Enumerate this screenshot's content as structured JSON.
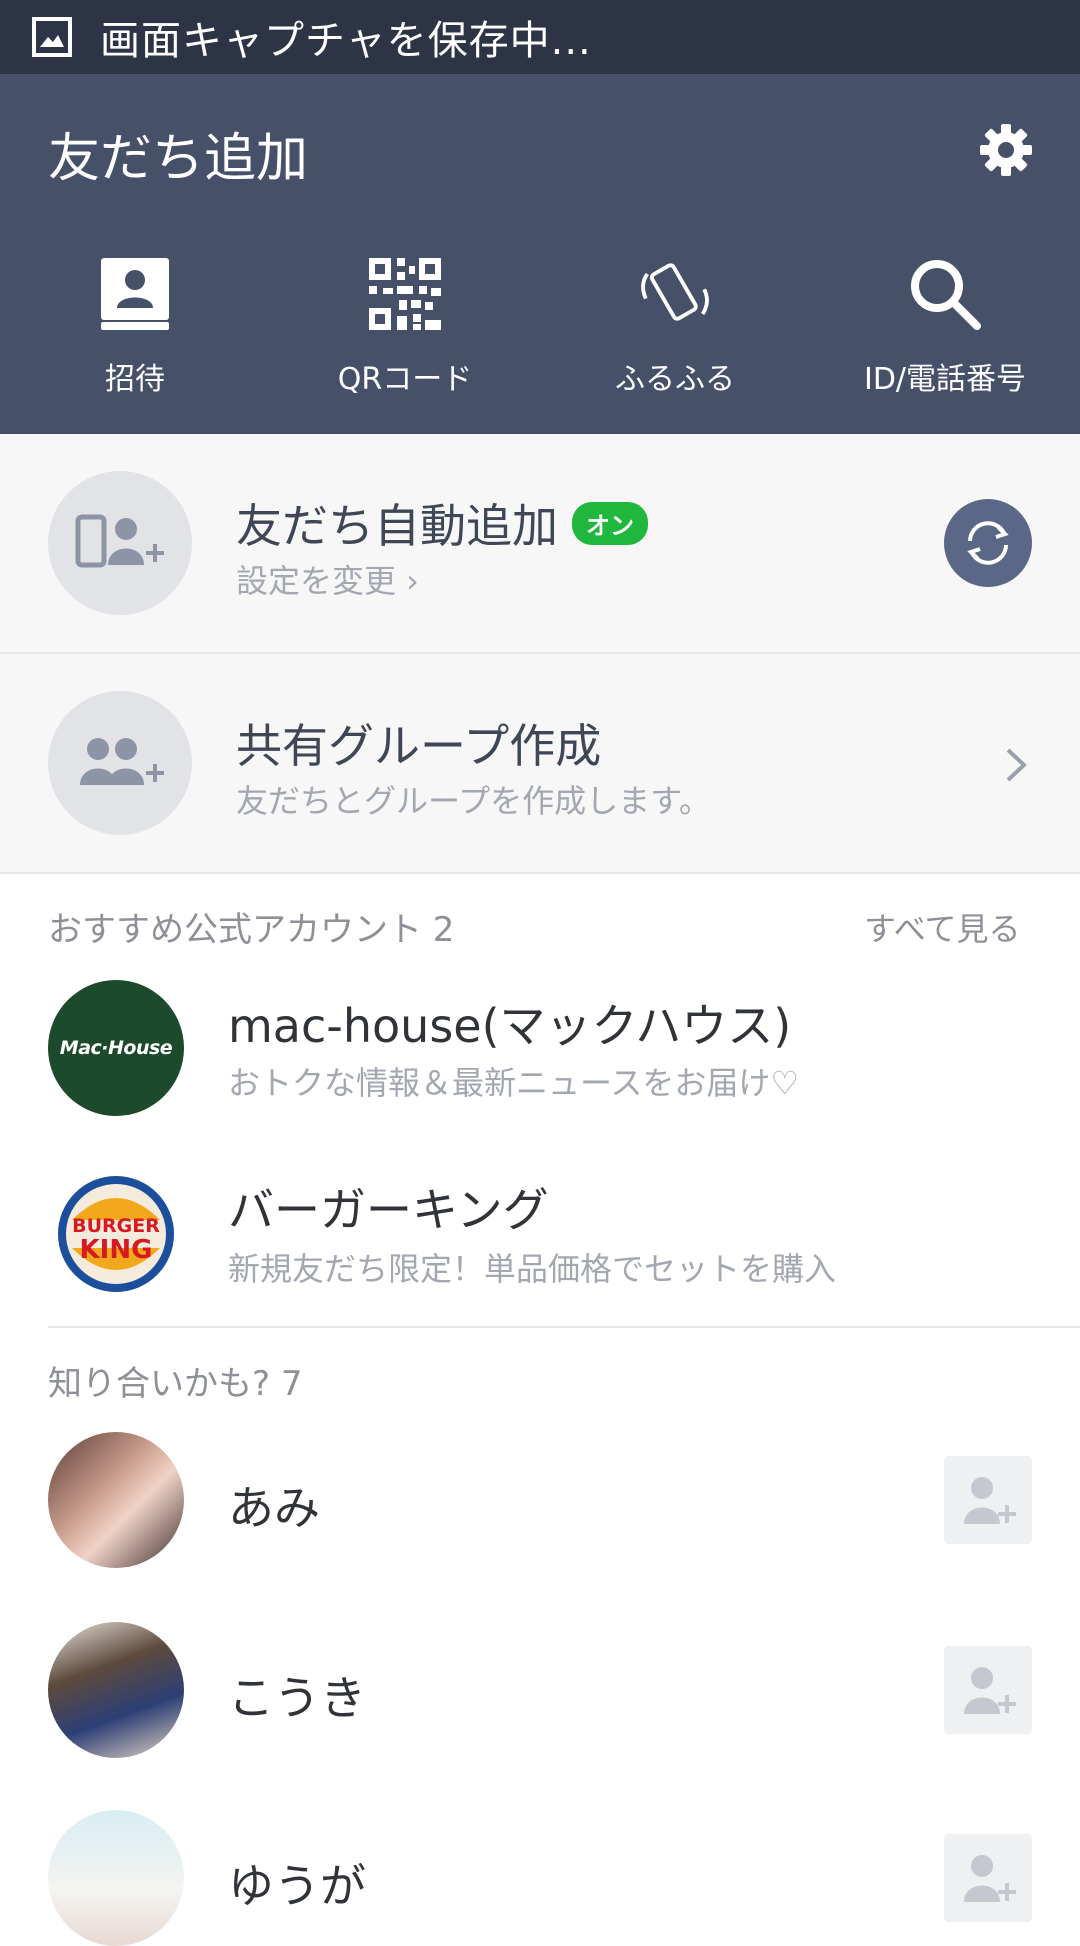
{
  "status_bar": {
    "text": "画面キャプチャを保存中..."
  },
  "header": {
    "title": "友だち追加",
    "menu": [
      {
        "label": "招待",
        "icon": "contact-book-icon"
      },
      {
        "label": "QRコード",
        "icon": "qr-code-icon"
      },
      {
        "label": "ふるふる",
        "icon": "shake-phone-icon"
      },
      {
        "label": "ID/電話番号",
        "icon": "search-icon"
      }
    ]
  },
  "auto_add": {
    "title": "友だち自動追加",
    "badge": "オン",
    "subtitle": "設定を変更 ›"
  },
  "shared_group": {
    "title": "共有グループ作成",
    "subtitle": "友だちとグループを作成します。"
  },
  "official": {
    "label": "おすすめ公式アカウント 2",
    "see_all": "すべて見る",
    "items": [
      {
        "name": "mac-house(マックハウス)",
        "sub": "おトクな情報＆最新ニュースをお届け♡",
        "logo_text": "Mac·House",
        "color": "#1d4a2c"
      },
      {
        "name": "バーガーキング",
        "sub": "新規友だち限定！単品価格でセットを購入",
        "logo_text": "BURGER KING"
      }
    ]
  },
  "suggest": {
    "label": "知り合いかも? 7",
    "items": [
      {
        "name": "あみ"
      },
      {
        "name": "こうき"
      },
      {
        "name": "ゆうが"
      }
    ]
  },
  "colors": {
    "header": "#465069",
    "status_bar": "#2c3446",
    "badge": "#1fb83c",
    "sync": "#5b6786"
  }
}
